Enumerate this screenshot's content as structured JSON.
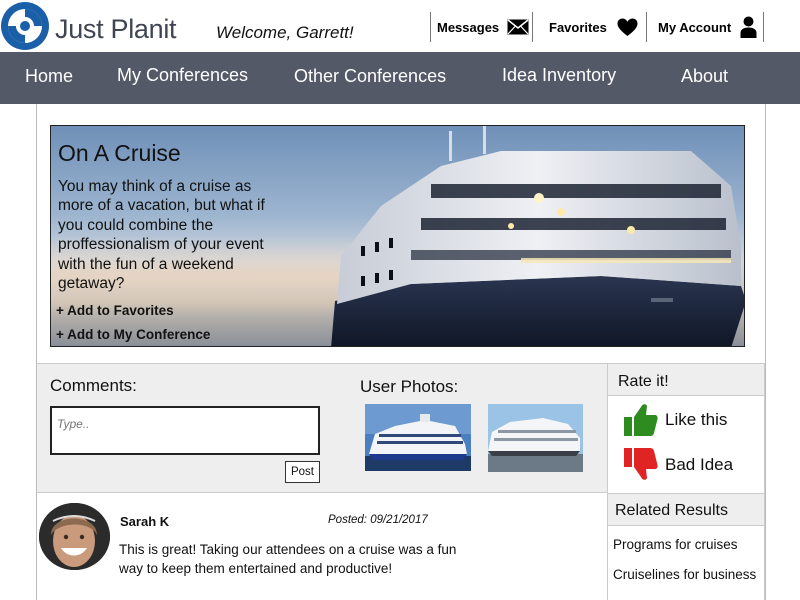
{
  "app": {
    "brand": "Just Planit",
    "welcome": "Welcome, Garrett!"
  },
  "topnav": {
    "messages": "Messages",
    "favorites": "Favorites",
    "account": "My Account"
  },
  "mainnav": {
    "items": [
      "Home",
      "My Conferences",
      "Other Conferences",
      "Idea Inventory",
      "About"
    ]
  },
  "hero": {
    "title": "On A Cruise",
    "description": "You may think of a cruise as more of a vacation, but what if you could combine the proffessionalism of your event with the fun of a weekend getaway?",
    "add_favorites": "+ Add to Favorites",
    "add_conference": "+ Add to My Conference"
  },
  "comments": {
    "label": "Comments:",
    "placeholder": "Type..",
    "post_label": "Post"
  },
  "photos": {
    "label": "User Photos:"
  },
  "rate": {
    "title": "Rate it!",
    "like": "Like this",
    "dislike": "Bad Idea"
  },
  "related": {
    "title": "Related Results",
    "items": [
      "Programs for cruises",
      "Cruiselines for business"
    ]
  },
  "post": {
    "author": "Sarah K",
    "posted": "Posted: 09/21/2017",
    "text": "This is great! Taking our attendees on a cruise was a fun way to keep them entertained and productive!"
  },
  "colors": {
    "nav_bg": "#545968",
    "brand_text": "#3f4553",
    "logo_blue": "#1a5fa8",
    "thumbs_up": "#2e8b1f",
    "thumbs_down": "#e02424",
    "panel_bg": "#eeeeee"
  },
  "icons": {
    "messages": "envelope-icon",
    "favorites": "heart-icon",
    "account": "person-icon",
    "like": "thumbs-up-icon",
    "dislike": "thumbs-down-icon"
  }
}
